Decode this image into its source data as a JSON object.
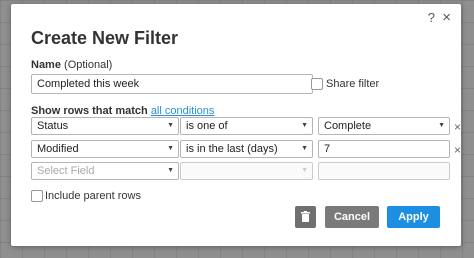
{
  "dialog": {
    "title": "Create New Filter",
    "help_glyph": "?",
    "close_glyph": "×"
  },
  "name_field": {
    "label_bold": "Name",
    "label_optional": "(Optional)",
    "value": "Completed this week"
  },
  "share_filter": {
    "label": "Share filter",
    "checked": false
  },
  "rows_match": {
    "prefix": "Show rows that match",
    "link": "all conditions"
  },
  "conditions": [
    {
      "field": "Status",
      "operator": "is one of",
      "value": "Complete",
      "value_is_select": true
    },
    {
      "field": "Modified",
      "operator": "is in the last (days)",
      "value": "7",
      "value_is_select": false
    }
  ],
  "new_condition": {
    "field_placeholder": "Select Field"
  },
  "include_parent": {
    "label": "Include parent rows",
    "checked": false
  },
  "buttons": {
    "cancel": "Cancel",
    "apply": "Apply"
  },
  "icons": {
    "remove": "×",
    "arrow": "▼",
    "trash": "trash-icon"
  },
  "colors": {
    "apply": "#1d8fe2",
    "cancel": "#7a7a7a",
    "trash": "#707070",
    "link": "#2a8fd9"
  }
}
